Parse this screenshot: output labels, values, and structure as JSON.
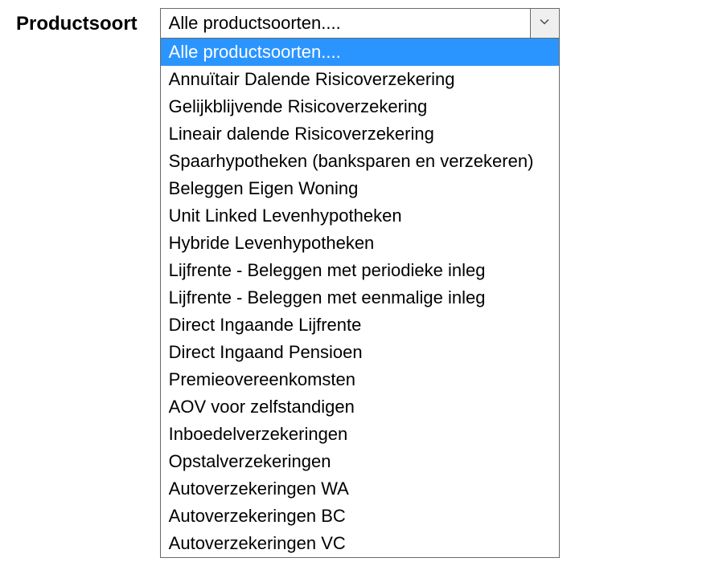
{
  "form": {
    "label": "Productsoort",
    "selected_value": "Alle productsoorten....",
    "options": [
      {
        "label": "Alle productsoorten....",
        "selected": true
      },
      {
        "label": "Annuïtair Dalende Risicoverzekering",
        "selected": false
      },
      {
        "label": "Gelijkblijvende Risicoverzekering",
        "selected": false
      },
      {
        "label": "Lineair dalende Risicoverzekering",
        "selected": false
      },
      {
        "label": "Spaarhypotheken (banksparen en verzekeren)",
        "selected": false
      },
      {
        "label": "Beleggen Eigen Woning",
        "selected": false
      },
      {
        "label": "Unit Linked Levenhypotheken",
        "selected": false
      },
      {
        "label": "Hybride Levenhypotheken",
        "selected": false
      },
      {
        "label": "Lijfrente - Beleggen met periodieke inleg",
        "selected": false
      },
      {
        "label": "Lijfrente - Beleggen met eenmalige inleg",
        "selected": false
      },
      {
        "label": "Direct Ingaande Lijfrente",
        "selected": false
      },
      {
        "label": "Direct Ingaand Pensioen",
        "selected": false
      },
      {
        "label": "Premieovereenkomsten",
        "selected": false
      },
      {
        "label": "AOV voor zelfstandigen",
        "selected": false
      },
      {
        "label": "Inboedelverzekeringen",
        "selected": false
      },
      {
        "label": "Opstalverzekeringen",
        "selected": false
      },
      {
        "label": "Autoverzekeringen WA",
        "selected": false
      },
      {
        "label": "Autoverzekeringen BC",
        "selected": false
      },
      {
        "label": "Autoverzekeringen VC",
        "selected": false
      }
    ]
  }
}
